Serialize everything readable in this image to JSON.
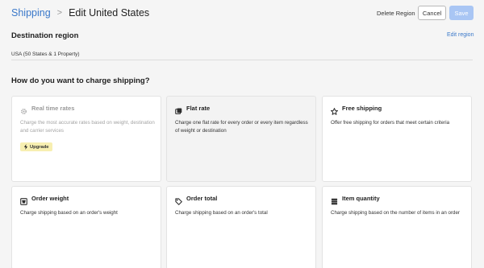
{
  "header": {
    "breadcrumb_parent": "Shipping",
    "breadcrumb_separator": ">",
    "breadcrumb_current": "Edit United States",
    "delete_label": "Delete Region",
    "cancel_label": "Cancel",
    "save_label": "Save"
  },
  "destination": {
    "title": "Destination region",
    "edit_label": "Edit region",
    "value": "USA (50 States & 1 Property)"
  },
  "charge": {
    "title": "How do you want to charge shipping?",
    "options": [
      {
        "title": "Real time rates",
        "description": "Charge the most accurate rates based on weight, destination and carrier services",
        "icon": "gear-icon",
        "state": "disabled",
        "badge": "Upgrade"
      },
      {
        "title": "Flat rate",
        "description": "Charge one flat rate for every order or every item regardless of weight or destination",
        "icon": "flat-rate-icon",
        "state": "selected"
      },
      {
        "title": "Free shipping",
        "description": "Offer free shipping for orders that meet certain criteria",
        "icon": "star-icon",
        "state": "default"
      },
      {
        "title": "Order weight",
        "description": "Charge shipping based on an order's weight",
        "icon": "scale-icon",
        "state": "default"
      },
      {
        "title": "Order total",
        "description": "Charge shipping based on an order's total",
        "icon": "tag-icon",
        "state": "default"
      },
      {
        "title": "Item quantity",
        "description": "Charge shipping based on the number of items in an order",
        "icon": "stack-icon",
        "state": "default"
      }
    ]
  },
  "colors": {
    "link": "#3a78c9",
    "save_disabled": "#a9c6f4",
    "upgrade_badge": "#f7efb1",
    "page_background": "#f5f5f5"
  }
}
